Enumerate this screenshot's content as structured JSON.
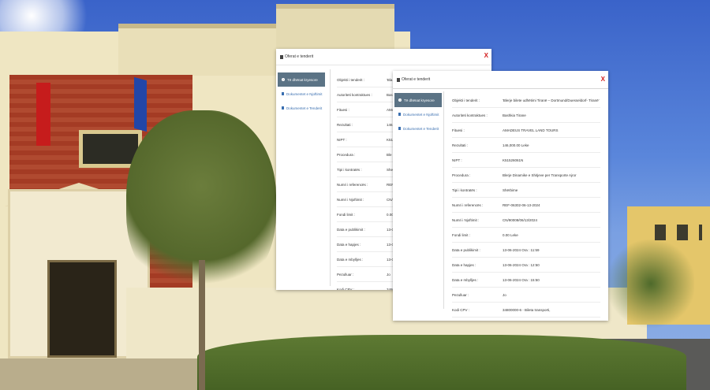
{
  "colors": {
    "accent_nav_active": "#5b7385",
    "link_blue": "#3a6fb0",
    "close_red": "#d21c1c"
  },
  "dialog_back": {
    "title": "Oferat e tenderit",
    "close_label": "X",
    "nav": [
      {
        "label": "Të dhënat kryesore",
        "icon": "info-icon"
      },
      {
        "label": "Dokumentet e Njoftimit",
        "icon": "document-icon"
      },
      {
        "label": "Dokumentet e Tenderit",
        "icon": "document-icon"
      }
    ],
    "rows": [
      {
        "label": "Objekti i tenderit :",
        "value": "'Bla"
      },
      {
        "label": "Autoriteti kontraktues :",
        "value": "Bas"
      },
      {
        "label": "Fituesi :",
        "value": "AMA"
      },
      {
        "label": "Rezultati :",
        "value": "146."
      },
      {
        "label": "NIPT :",
        "value": "K51"
      },
      {
        "label": "Procedura :",
        "value": "Ble"
      },
      {
        "label": "Tipi i kontratës :",
        "value": "She"
      },
      {
        "label": "Numri i referencës :",
        "value": "REF"
      },
      {
        "label": "Numri i Njoftimit :",
        "value": "CN/"
      },
      {
        "label": "Fondi limit :",
        "value": "0.00"
      },
      {
        "label": "Data e publikimit :",
        "value": "13-0"
      },
      {
        "label": "Data e hapjes :",
        "value": "13-0"
      },
      {
        "label": "Data e mbylljes :",
        "value": "13-0"
      },
      {
        "label": "Pezulluar :",
        "value": "Jo"
      },
      {
        "label": "Kodi CPV :",
        "value": "3480"
      }
    ]
  },
  "dialog_front": {
    "title": "Oferat e tenderit",
    "close_label": "X",
    "nav": [
      {
        "label": "Të dhënat kryesore",
        "icon": "info-icon"
      },
      {
        "label": "Dokumentet e Njoftimit",
        "icon": "document-icon"
      },
      {
        "label": "Dokumentet e Tenderit",
        "icon": "document-icon"
      }
    ],
    "rows": [
      {
        "label": "Objekti i tenderit :",
        "value": "'Blerje bilete udhëtimi Tiranë – Dortmund/Duesseldorf- Tiranë'"
      },
      {
        "label": "Autoriteti kontraktues :",
        "value": "Bashkia Tirane"
      },
      {
        "label": "Fituesi :",
        "value": "AMADEUS TRAVEL LAND TOURS"
      },
      {
        "label": "Rezultati :",
        "value": "146,000.00 Leke"
      },
      {
        "label": "NIPT :",
        "value": "K51526061N"
      },
      {
        "label": "Procedura :",
        "value": "Blerje Dinamike e Shitjeve per Transporte Ajror"
      },
      {
        "label": "Tipi i kontratës :",
        "value": "Shërbime"
      },
      {
        "label": "Numri i referencës :",
        "value": "REF-06302-06-13-2024"
      },
      {
        "label": "Numri i Njoftimit :",
        "value": "CN/90008/06/13/2024"
      },
      {
        "label": "Fondi limit :",
        "value": "0.00 Leke"
      },
      {
        "label": "Data e publikimit :",
        "value": "13-06-2024 Ora : 11:59"
      },
      {
        "label": "Data e hapjes :",
        "value": "13-06-2024 Ora : 12:50"
      },
      {
        "label": "Data e mbylljes :",
        "value": "13-06-2024 Ora : 15:50"
      },
      {
        "label": "Pezulluar :",
        "value": "Jo"
      },
      {
        "label": "Kodi CPV :",
        "value": "34800000-6 - Bileta transporti,"
      }
    ]
  }
}
